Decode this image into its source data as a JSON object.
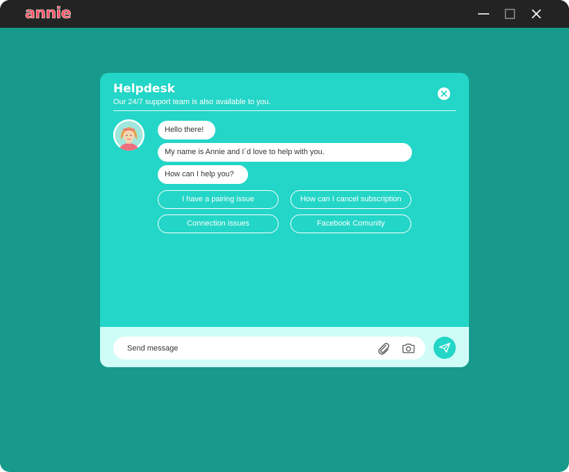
{
  "app": {
    "logo_text": "annie",
    "logo_color": "#ff5263",
    "titlebar_color": "#232323",
    "background_color": "#17998c"
  },
  "window_controls": {
    "minimize_icon": "minimize-icon",
    "maximize_icon": "maximize-icon",
    "close_icon": "close-icon"
  },
  "helpdesk": {
    "title": "Helpdesk",
    "subtitle": "Our 24/7 support team is also available to you.",
    "accent_color": "#23d6c7",
    "close_icon": "close-circle-icon",
    "messages": [
      "Hello there!",
      "My name is Annie and I´d love to help with you.",
      "How can I help you?"
    ],
    "quick_replies": [
      "I have a pairing issue",
      "How can I cancel subscription",
      "Connection issues",
      "Facebook Comunity"
    ]
  },
  "composer": {
    "placeholder": "Send message",
    "value": "",
    "attach_icon": "paperclip-icon",
    "camera_icon": "camera-icon",
    "send_icon": "send-icon"
  }
}
